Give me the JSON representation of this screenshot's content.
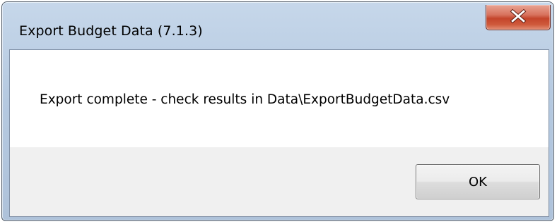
{
  "window": {
    "title": "Export Budget Data (7.1.3)"
  },
  "dialog": {
    "message": "Export complete - check results in Data\\ExportBudgetData.csv",
    "ok_label": "OK"
  },
  "icons": {
    "close": "close-icon"
  },
  "colors": {
    "close_button": "#c4452b",
    "titlebar": "#b5c9e0",
    "message_background": "#ffffff",
    "button_area_background": "#f0f0f0"
  }
}
